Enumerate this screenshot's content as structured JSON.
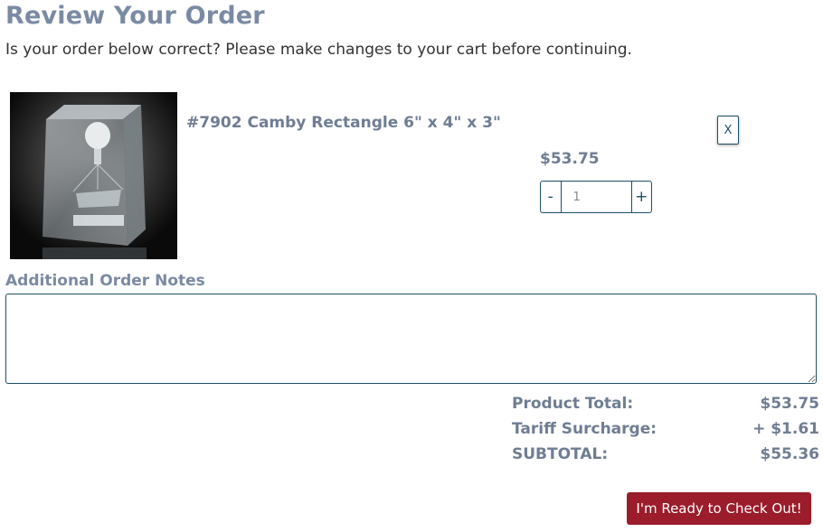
{
  "page": {
    "title": "Review Your Order",
    "subtitle": "Is your order below correct? Please make changes to your cart before continuing."
  },
  "cart_item": {
    "name": "#7902 Camby Rectangle 6\" x 4\" x 3\"",
    "price": "$53.75",
    "quantity": "1",
    "remove_label": "X",
    "decrease_label": "-",
    "increase_label": "+",
    "image_icon": "crystal-golf-award-image"
  },
  "notes": {
    "label": "Additional Order Notes",
    "value": ""
  },
  "totals": {
    "product_total_label": "Product Total:",
    "product_total_value": "$53.75",
    "tariff_label": "Tariff Surcharge:",
    "tariff_value": "+ $1.61",
    "subtotal_label": "SUBTOTAL:",
    "subtotal_value": "$55.36"
  },
  "checkout": {
    "label": "I'm Ready to Check Out!"
  },
  "colors": {
    "heading": "#7b8aa3",
    "border": "#1d4f69",
    "checkout_bg": "#9b1c2b"
  }
}
